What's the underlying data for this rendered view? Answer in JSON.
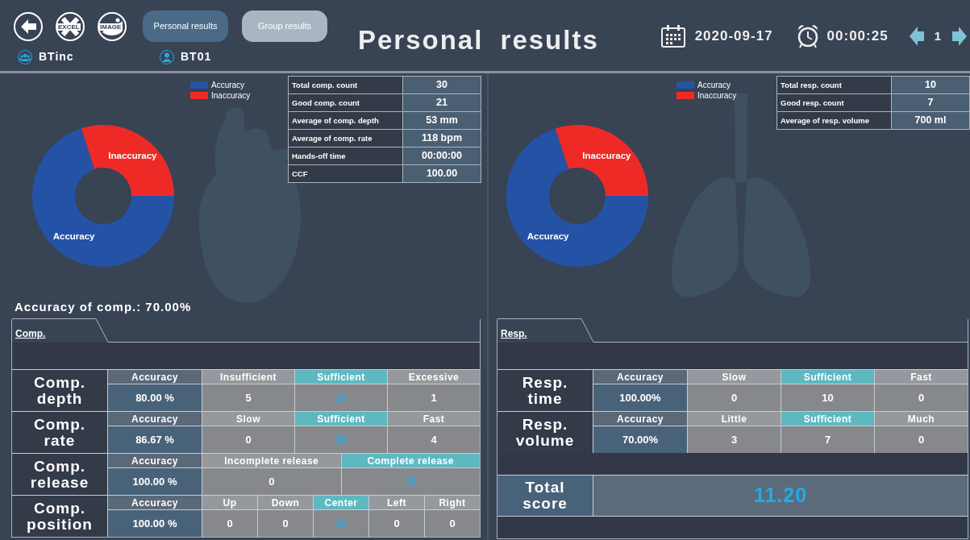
{
  "toolbar": [
    {
      "kind": "back"
    },
    {
      "kind": "excel",
      "label": "EXCEL"
    },
    {
      "kind": "image",
      "label": "IMAGE"
    }
  ],
  "view_tabs": [
    {
      "label": "Personal results",
      "selected": true
    },
    {
      "label": "Group results",
      "selected": false
    }
  ],
  "users": [
    {
      "kind": "group",
      "name": "BTinc"
    },
    {
      "kind": "person",
      "name": "BT01"
    }
  ],
  "title": "Personal results",
  "date": "2020-09-17",
  "time": "00:00:25",
  "page": "1",
  "panels": [
    {
      "kind": "heart",
      "chart_data": {
        "type": "donut",
        "categories": [
          "Accuracy",
          "Inaccuracy"
        ],
        "values": [
          70,
          30
        ],
        "colors": [
          "#2453a6",
          "#ee2a27"
        ],
        "value_labels": [
          "Accuracy",
          "Inaccuracy"
        ],
        "legend": "top-right"
      },
      "stats": [
        {
          "label": "Total comp. count",
          "value": "30"
        },
        {
          "label": "Good comp. count",
          "value": "21"
        },
        {
          "label": "Average of comp. depth",
          "value": "53  mm"
        },
        {
          "label": "Average of comp. rate",
          "value": "118  bpm"
        },
        {
          "label": "Hands-off time",
          "value": "00:00:00"
        },
        {
          "label": "CCF",
          "value": "100.00"
        }
      ],
      "summary": "Accuracy of comp.: 70.00%",
      "tab": "Comp.",
      "metrics": [
        {
          "name": "Comp. depth",
          "accuracy_label": "Accuracy",
          "accuracy": "80.00 %",
          "categories": [
            {
              "label": "Insufficient",
              "value": "5",
              "highlighted": false,
              "value_emphasized": false
            },
            {
              "label": "Sufficient",
              "value": "24",
              "highlighted": true,
              "value_emphasized": true
            },
            {
              "label": "Excessive",
              "value": "1",
              "highlighted": false,
              "value_emphasized": false
            }
          ]
        },
        {
          "name": "Comp. rate",
          "accuracy_label": "Accuracy",
          "accuracy": "86.67 %",
          "categories": [
            {
              "label": "Slow",
              "value": "0",
              "highlighted": false,
              "value_emphasized": false
            },
            {
              "label": "Sufficient",
              "value": "26",
              "highlighted": true,
              "value_emphasized": true
            },
            {
              "label": "Fast",
              "value": "4",
              "highlighted": false,
              "value_emphasized": false
            }
          ]
        },
        {
          "name": "Comp. release",
          "accuracy_label": "Accuracy",
          "accuracy": "100.00 %",
          "categories": [
            {
              "label": "Incomplete release",
              "value": "0",
              "highlighted": false,
              "value_emphasized": false
            },
            {
              "label": "Complete release",
              "value": "30",
              "highlighted": true,
              "value_emphasized": true
            }
          ]
        },
        {
          "name": "Comp. position",
          "accuracy_label": "Accuracy",
          "accuracy": "100.00 %",
          "categories": [
            {
              "label": "Up",
              "value": "0",
              "highlighted": false,
              "value_emphasized": false
            },
            {
              "label": "Down",
              "value": "0",
              "highlighted": false,
              "value_emphasized": false
            },
            {
              "label": "Center",
              "value": "30",
              "highlighted": true,
              "value_emphasized": true
            },
            {
              "label": "Left",
              "value": "0",
              "highlighted": false,
              "value_emphasized": false
            },
            {
              "label": "Right",
              "value": "0",
              "highlighted": false,
              "value_emphasized": false
            }
          ]
        }
      ]
    },
    {
      "kind": "lungs",
      "chart_data": {
        "type": "donut",
        "categories": [
          "Accuracy",
          "Inaccuracy"
        ],
        "values": [
          70,
          30
        ],
        "colors": [
          "#2453a6",
          "#ee2a27"
        ],
        "value_labels": [
          "Accuracy",
          "Inaccuracy"
        ],
        "legend": "top-right"
      },
      "stats": [
        {
          "label": "Total resp. count",
          "value": "10"
        },
        {
          "label": "Good resp. count",
          "value": "7"
        },
        {
          "label": "Average of resp. volume",
          "value": "700 ml"
        }
      ],
      "tab": "Resp.",
      "metrics": [
        {
          "name": "Resp. time",
          "accuracy_label": "Accuracy",
          "accuracy": "100.00%",
          "categories": [
            {
              "label": "Slow",
              "value": "0",
              "highlighted": false,
              "value_emphasized": false
            },
            {
              "label": "Sufficient",
              "value": "10",
              "highlighted": true,
              "value_emphasized": false
            },
            {
              "label": "Fast",
              "value": "0",
              "highlighted": false,
              "value_emphasized": false
            }
          ]
        },
        {
          "name": "Resp. volume",
          "accuracy_label": "Accuracy",
          "accuracy": "70.00%",
          "categories": [
            {
              "label": "Little",
              "value": "3",
              "highlighted": false,
              "value_emphasized": false
            },
            {
              "label": "Sufficient",
              "value": "7",
              "highlighted": true,
              "value_emphasized": false
            },
            {
              "label": "Much",
              "value": "0",
              "highlighted": false,
              "value_emphasized": false
            }
          ]
        }
      ],
      "total": {
        "label": "Total score",
        "value": "11.20"
      }
    }
  ]
}
